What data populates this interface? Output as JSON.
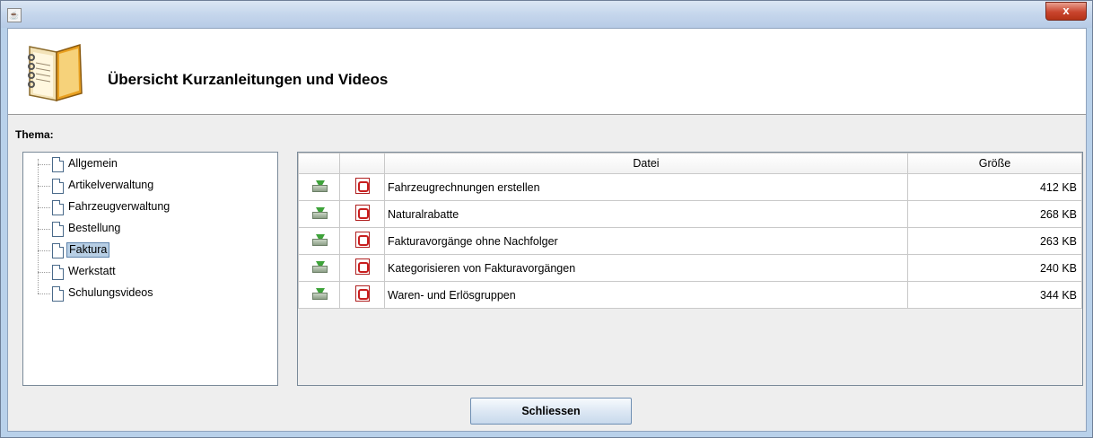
{
  "window": {
    "close_glyph": "x",
    "app_icon": "java-icon"
  },
  "header": {
    "title": "Übersicht Kurzanleitungen und Videos",
    "icon": "book-icon"
  },
  "thema_label": "Thema:",
  "tree": {
    "items": [
      {
        "label": "Allgemein",
        "selected": false
      },
      {
        "label": "Artikelverwaltung",
        "selected": false
      },
      {
        "label": "Fahrzeugverwaltung",
        "selected": false
      },
      {
        "label": "Bestellung",
        "selected": false
      },
      {
        "label": "Faktura",
        "selected": true
      },
      {
        "label": "Werkstatt",
        "selected": false
      },
      {
        "label": "Schulungsvideos",
        "selected": false
      }
    ]
  },
  "table": {
    "columns": [
      "",
      "",
      "Datei",
      "Größe"
    ],
    "rows": [
      {
        "file": "Fahrzeugrechnungen erstellen",
        "size": "412 KB"
      },
      {
        "file": "Naturalrabatte",
        "size": "268 KB"
      },
      {
        "file": "Fakturavorgänge ohne Nachfolger",
        "size": "263 KB"
      },
      {
        "file": "Kategorisieren von Fakturavorgängen",
        "size": "240 KB"
      },
      {
        "file": "Waren- und Erlösgruppen",
        "size": "344 KB"
      }
    ]
  },
  "buttons": {
    "close_label": "Schliessen"
  }
}
